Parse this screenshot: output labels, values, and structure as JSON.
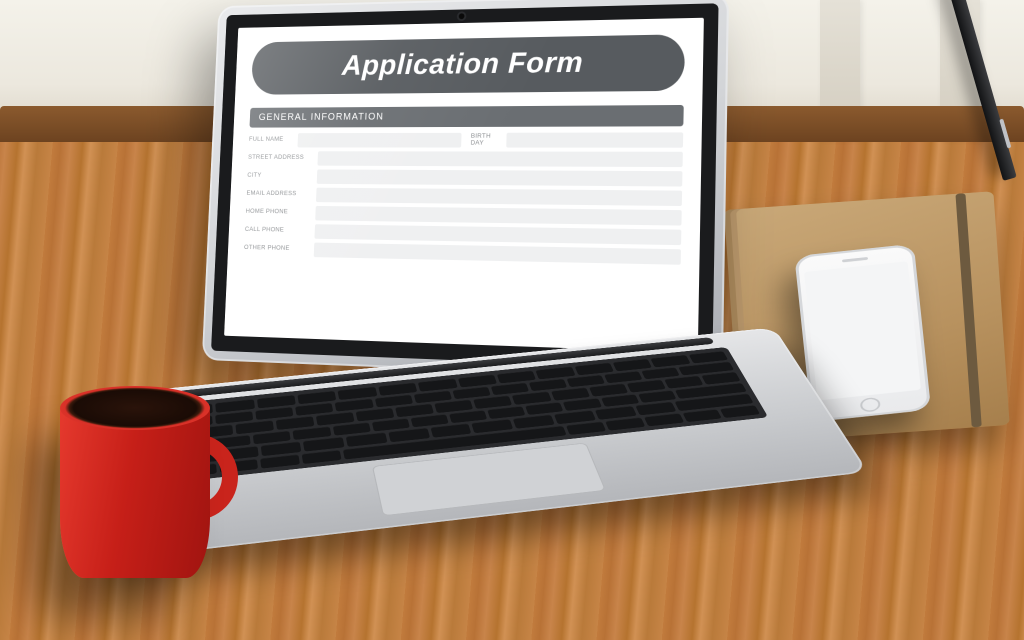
{
  "form": {
    "title": "Application Form",
    "section_label": "GENERAL INFORMATION",
    "fields": {
      "full_name_label": "FULL NAME",
      "birth_day_label": "BIRTH DAY",
      "street_address_label": "STREET ADDRESS",
      "city_label": "CITY",
      "email_label": "EMAIL ADDRESS",
      "home_phone_label": "HOME PHONE",
      "call_phone_label": "CALL PHONE",
      "other_phone_label": "OTHER PHONE"
    }
  }
}
